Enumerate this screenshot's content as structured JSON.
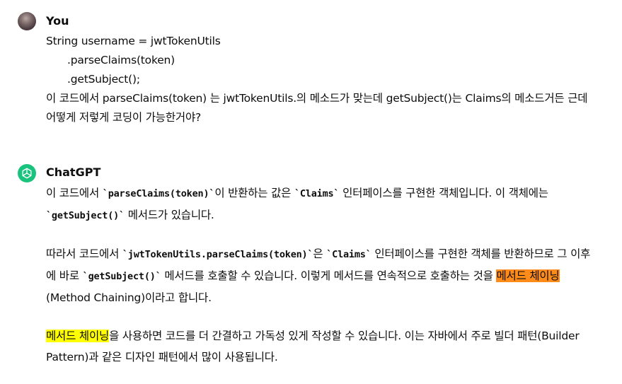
{
  "user_message": {
    "author": "You",
    "code_lines": [
      "String username = jwtTokenUtils",
      ".parseClaims(token)",
      ".getSubject();"
    ],
    "question": " 이 코드에서 parseClaims(token) 는 jwtTokenUtils.의 메소드가 맞는데 getSubject()는 Claims의 메소드거든 근데 어떻게 저렇게 코딩이 가능한거야?"
  },
  "assistant_message": {
    "author": "ChatGPT",
    "p1": {
      "t1": "이 코드에서 ",
      "c1": "`parseClaims(token)`",
      "t2": "이 반환하는 값은 ",
      "c2": "`Claims`",
      "t3": " 인터페이스를 구현한 객체입니다. 이 객체에는 ",
      "c3": "`getSubject()`",
      "t4": " 메서드가 있습니다."
    },
    "p2": {
      "t1": "따라서 코드에서 ",
      "c1": "`jwtTokenUtils.parseClaims(token)`",
      "t2": "은 ",
      "c2": "`Claims`",
      "t3": " 인터페이스를 구현한 객체를 반환하므로 그 이후에 바로 ",
      "c3": "`getSubject()`",
      "t4": " 메서드를 호출할 수 있습니다. 이렇게 메서드를 연속적으로 호출하는 것을 ",
      "hl": "메서드 체이닝",
      "t5": "(Method Chaining)이라고 합니다."
    },
    "p3": {
      "hl": "메서드 체이닝",
      "t1": "을 사용하면 코드를 더 간결하고 가독성 있게 작성할 수 있습니다. 이는 자바에서 주로 빌더 패턴(Builder Pattern)과 같은 디자인 패턴에서 많이 사용됩니다."
    }
  },
  "colors": {
    "gpt_avatar_bg": "#19c37d",
    "highlight_orange": "#ff8c1a",
    "highlight_yellow": "#ffff00",
    "text": "#0d0d0d"
  },
  "icons": {
    "user_avatar": "user-photo-avatar",
    "gpt_avatar": "openai-logo-icon"
  }
}
